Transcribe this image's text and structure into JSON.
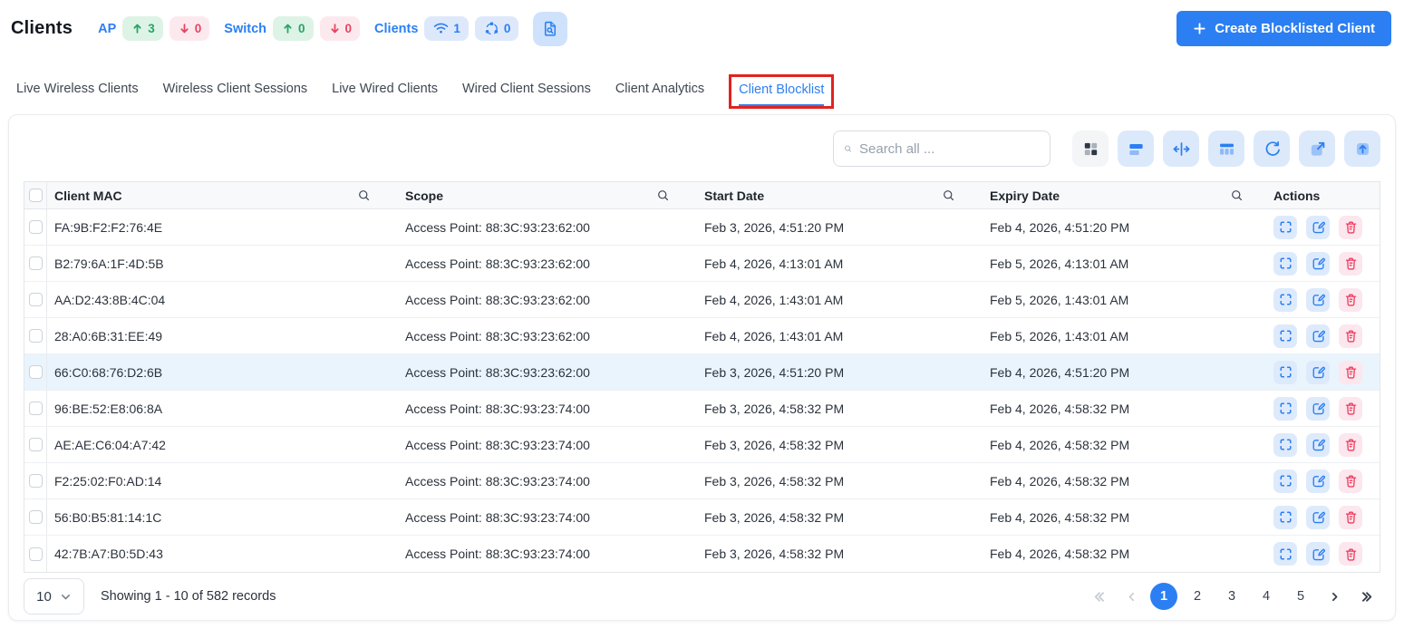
{
  "header": {
    "title": "Clients",
    "ap": {
      "label": "AP",
      "up": "3",
      "down": "0"
    },
    "switch": {
      "label": "Switch",
      "up": "0",
      "down": "0"
    },
    "clients": {
      "label": "Clients",
      "wireless": "1",
      "mesh": "0"
    },
    "create_button_label": "Create Blocklisted Client"
  },
  "tabs": [
    {
      "label": "Live Wireless Clients",
      "active": false,
      "annotated": false
    },
    {
      "label": "Wireless Client Sessions",
      "active": false,
      "annotated": false
    },
    {
      "label": "Live Wired Clients",
      "active": false,
      "annotated": false
    },
    {
      "label": "Wired Client Sessions",
      "active": false,
      "annotated": false
    },
    {
      "label": "Client Analytics",
      "active": false,
      "annotated": false
    },
    {
      "label": "Client Blocklist",
      "active": true,
      "annotated": true
    }
  ],
  "toolbar": {
    "search_placeholder": "Search all ...",
    "buttons": [
      "grid-view",
      "row-density",
      "fit-columns",
      "manage-columns",
      "refresh",
      "open-in-new",
      "export"
    ]
  },
  "table": {
    "headers": {
      "client_mac": "Client MAC",
      "scope": "Scope",
      "start_date": "Start Date",
      "expiry_date": "Expiry Date",
      "actions": "Actions"
    },
    "row_actions": [
      "expand",
      "edit",
      "delete"
    ],
    "rows": [
      {
        "mac": "FA:9B:F2:F2:76:4E",
        "scope": "Access Point: 88:3C:93:23:62:00",
        "start": "Feb 3, 2026, 4:51:20 PM",
        "expiry": "Feb 4, 2026, 4:51:20 PM",
        "highlighted": false
      },
      {
        "mac": "B2:79:6A:1F:4D:5B",
        "scope": "Access Point: 88:3C:93:23:62:00",
        "start": "Feb 4, 2026, 4:13:01 AM",
        "expiry": "Feb 5, 2026, 4:13:01 AM",
        "highlighted": false
      },
      {
        "mac": "AA:D2:43:8B:4C:04",
        "scope": "Access Point: 88:3C:93:23:62:00",
        "start": "Feb 4, 2026, 1:43:01 AM",
        "expiry": "Feb 5, 2026, 1:43:01 AM",
        "highlighted": false
      },
      {
        "mac": "28:A0:6B:31:EE:49",
        "scope": "Access Point: 88:3C:93:23:62:00",
        "start": "Feb 4, 2026, 1:43:01 AM",
        "expiry": "Feb 5, 2026, 1:43:01 AM",
        "highlighted": false
      },
      {
        "mac": "66:C0:68:76:D2:6B",
        "scope": "Access Point: 88:3C:93:23:62:00",
        "start": "Feb 3, 2026, 4:51:20 PM",
        "expiry": "Feb 4, 2026, 4:51:20 PM",
        "highlighted": true
      },
      {
        "mac": "96:BE:52:E8:06:8A",
        "scope": "Access Point: 88:3C:93:23:74:00",
        "start": "Feb 3, 2026, 4:58:32 PM",
        "expiry": "Feb 4, 2026, 4:58:32 PM",
        "highlighted": false
      },
      {
        "mac": "AE:AE:C6:04:A7:42",
        "scope": "Access Point: 88:3C:93:23:74:00",
        "start": "Feb 3, 2026, 4:58:32 PM",
        "expiry": "Feb 4, 2026, 4:58:32 PM",
        "highlighted": false
      },
      {
        "mac": "F2:25:02:F0:AD:14",
        "scope": "Access Point: 88:3C:93:23:74:00",
        "start": "Feb 3, 2026, 4:58:32 PM",
        "expiry": "Feb 4, 2026, 4:58:32 PM",
        "highlighted": false
      },
      {
        "mac": "56:B0:B5:81:14:1C",
        "scope": "Access Point: 88:3C:93:23:74:00",
        "start": "Feb 3, 2026, 4:58:32 PM",
        "expiry": "Feb 4, 2026, 4:58:32 PM",
        "highlighted": false
      },
      {
        "mac": "42:7B:A7:B0:5D:43",
        "scope": "Access Point: 88:3C:93:23:74:00",
        "start": "Feb 3, 2026, 4:58:32 PM",
        "expiry": "Feb 4, 2026, 4:58:32 PM",
        "highlighted": false
      }
    ]
  },
  "pagination": {
    "page_size": "10",
    "showing": "Showing 1 - 10 of 582 records",
    "pages": [
      "1",
      "2",
      "3",
      "4",
      "5"
    ],
    "active_page": "1"
  },
  "colors": {
    "primary_blue": "#2b7ff3",
    "active_tab_blue": "#2f80ed",
    "badge_green_bg": "#ddf3e6",
    "badge_green_text": "#27a567",
    "badge_red_bg": "#fce9ee",
    "badge_red_text": "#e8445f",
    "badge_blue_bg": "#dde9fb",
    "annotation_red": "#e0231f",
    "row_highlight": "#eaf4fd",
    "delete_red": "#ef3b5f"
  }
}
